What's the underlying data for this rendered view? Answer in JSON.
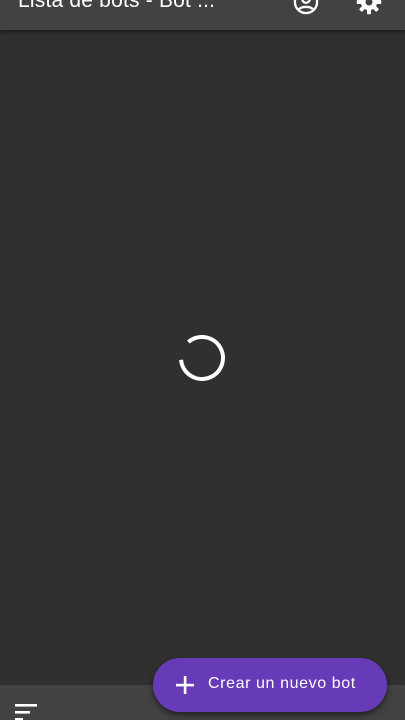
{
  "app_bar": {
    "title": "Lista de bots - Bot ...",
    "actions": [
      {
        "icon": "account-circle-icon"
      },
      {
        "icon": "settings-gear-icon"
      }
    ]
  },
  "content": {
    "state": "loading",
    "spinner_icon": "progress-spinner-icon"
  },
  "fab": {
    "icon": "plus-icon",
    "label": "Crear un nuevo bot"
  },
  "bottom_bar": {
    "sort_icon": "sort-icon"
  },
  "colors": {
    "background": "#303030",
    "app_bar": "#424242",
    "accent": "#673ab7",
    "text": "#ffffff"
  }
}
